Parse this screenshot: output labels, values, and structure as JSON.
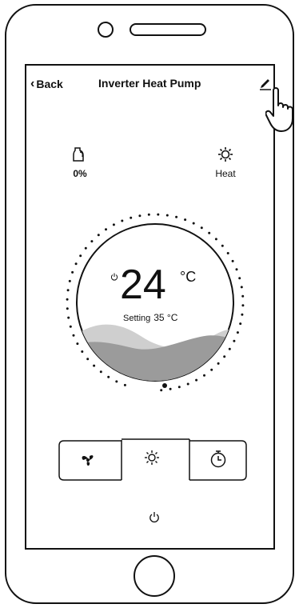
{
  "header": {
    "back_label": "Back",
    "title": "Inverter Heat Pump",
    "edit_icon": "pencil-icon"
  },
  "status": {
    "water_percent": "0%",
    "mode_label": "Heat",
    "water_icon": "water-jug-icon",
    "mode_icon": "sun-icon"
  },
  "dial": {
    "current_temp": "24",
    "unit": "°C",
    "setting_label": "Setting",
    "setting_value": "35 °C",
    "power_icon": "power-icon"
  },
  "tabs": [
    {
      "name": "fan",
      "icon": "fan-icon"
    },
    {
      "name": "heat",
      "icon": "sun-icon",
      "active": true
    },
    {
      "name": "timer",
      "icon": "timer-icon"
    }
  ],
  "bottom": {
    "power_icon": "power-icon"
  }
}
